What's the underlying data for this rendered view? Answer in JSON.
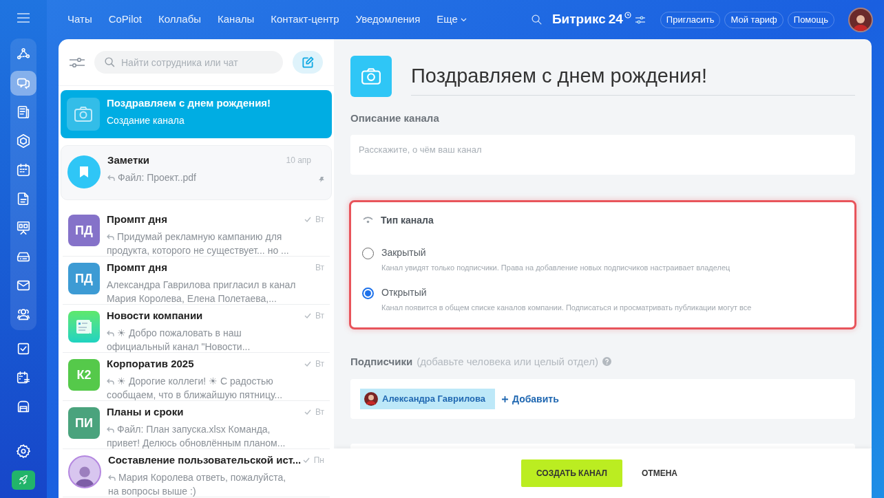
{
  "sidebar": {
    "pinned_items": [
      {
        "kind": "network",
        "selected": false
      },
      {
        "kind": "chat",
        "selected": true
      },
      {
        "kind": "news",
        "selected": false
      },
      {
        "kind": "hexagon",
        "selected": false
      },
      {
        "kind": "calendar",
        "selected": false
      },
      {
        "kind": "document",
        "selected": false
      },
      {
        "kind": "board",
        "selected": false
      },
      {
        "kind": "drive",
        "selected": false
      },
      {
        "kind": "mail",
        "selected": false
      },
      {
        "kind": "people",
        "selected": false
      }
    ],
    "items": [
      {
        "kind": "task",
        "selected": false
      },
      {
        "kind": "schedule",
        "selected": false
      },
      {
        "kind": "warehouse",
        "selected": false
      }
    ]
  },
  "top_nav": {
    "menu": [
      "Чаты",
      "CoPilot",
      "Коллабы",
      "Каналы",
      "Контакт-центр",
      "Уведомления"
    ],
    "more": "Еще",
    "logo": "Битрикс",
    "logo_number": "24",
    "buttons": [
      "Пригласить",
      "Мой тариф",
      "Помощь"
    ]
  },
  "chat_list": {
    "search": {
      "placeholder": "Найти сотрудника или чат"
    },
    "chats": [
      {
        "kind": "camera",
        "title": "Поздравляем с днем рождения!",
        "preview": "Создание канала",
        "selected": true,
        "reply": false,
        "read": false,
        "pinned": false
      },
      {
        "kind": "bookmark",
        "title": "Заметки",
        "preview": "Файл: Проект..pdf",
        "time": "10 апр",
        "selected": false,
        "reply": true,
        "read": false,
        "pinned": true
      },
      {
        "kind": "initials",
        "initials": "ПД",
        "color": "#8572c9",
        "title": "Промпт дня",
        "preview": "Придумай рекламную кампанию для продукта, которого не существует... но ...",
        "time": "Вт",
        "selected": false,
        "reply": true,
        "read": true,
        "pinned": false
      },
      {
        "kind": "initials",
        "initials": "ПД",
        "color": "#3d9bd4",
        "title": "Промпт дня",
        "preview": "Александра Гаврилова пригласил в канал Мария Королева, Елена Полетаева,...",
        "time": "Вт",
        "selected": false,
        "reply": false,
        "read": false,
        "pinned": false
      },
      {
        "kind": "news",
        "title": "Новости компании",
        "preview": "☀ Добро пожаловать в наш официальный канал \"Новости...",
        "time": "Вт",
        "selected": false,
        "reply": true,
        "read": true,
        "pinned": false
      },
      {
        "kind": "initials",
        "initials": "К2",
        "color": "#55c94a",
        "title": "Корпоратив 2025",
        "preview": "☀ Дорогие коллеги! ☀ С радостью сообщаем, что в ближайшую пятницу...",
        "time": "Вт",
        "selected": false,
        "reply": true,
        "read": true,
        "pinned": false
      },
      {
        "kind": "initials",
        "initials": "ПИ",
        "color": "#4aa37d",
        "title": "Планы и сроки",
        "preview": "Файл: План запуска.xlsx Команда, привет! Делюсь обновлённым планом...",
        "time": "Вт",
        "selected": false,
        "reply": true,
        "read": true,
        "pinned": false
      },
      {
        "kind": "photo",
        "title": "Составление пользовательской ист...",
        "preview": "Мария Королева ответь, пожалуйста, на вопросы выше :)",
        "time": "Пн",
        "selected": false,
        "reply": true,
        "read": true,
        "pinned": false
      }
    ]
  },
  "form": {
    "title": "Поздравляем с днем рождения!",
    "description_label": "Описание канала",
    "description": {
      "placeholder": "Расскажите, о чём ваш канал"
    },
    "type_card": {
      "title": "Тип канала",
      "highlighted": true,
      "options": [
        {
          "label": "Закрытый",
          "hint": "Канал увидят только подписчики. Права на добавление новых подписчиков настраивает владелец",
          "selected": false
        },
        {
          "label": "Открытый",
          "hint": "Канал появится в общем списке каналов компании. Подписаться и просматривать публикации могут все",
          "selected": true
        }
      ]
    },
    "subscribers_label": "Подписчики",
    "subscribers_hint": "(добавьте человека или целый отдел)",
    "subscribers": [
      "Александра Гаврилова"
    ],
    "add": "Добавить"
  },
  "footer": {
    "create": "СОЗДАТЬ КАНАЛ",
    "cancel": "ОТМЕНА"
  }
}
